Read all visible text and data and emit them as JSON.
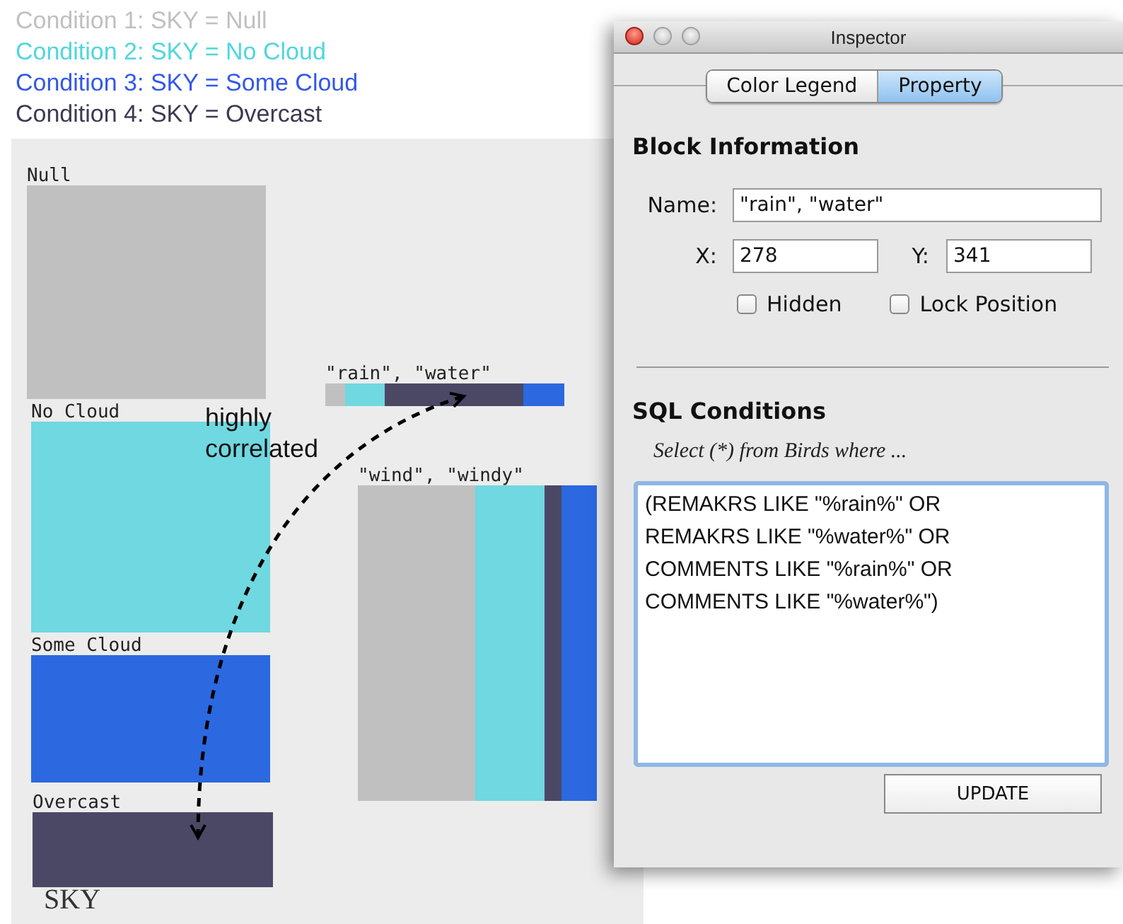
{
  "legend": [
    {
      "text": "Condition 1: SKY = Null",
      "color": "#c0c0c0"
    },
    {
      "text": "Condition 2: SKY = No Cloud",
      "color": "#4fd6de"
    },
    {
      "text": "Condition 3: SKY = Some Cloud",
      "color": "#3358e8"
    },
    {
      "text": "Condition 4: SKY = Overcast",
      "color": "#3c3a52"
    }
  ],
  "canvas": {
    "group_label": "SKY",
    "categories": [
      {
        "label": "Null",
        "color": "#c0c0c0"
      },
      {
        "label": "No Cloud",
        "color": "#70d8e0"
      },
      {
        "label": "Some Cloud",
        "color": "#2c68e0"
      },
      {
        "label": "Overcast",
        "color": "#4b4866"
      }
    ],
    "blocks": [
      {
        "label": "\"rain\", \"water\"",
        "segments": [
          {
            "color": "#c0c0c0"
          },
          {
            "color": "#70d8e0"
          },
          {
            "color": "#4b4866"
          },
          {
            "color": "#2c68e0"
          }
        ]
      },
      {
        "label": "\"wind\", \"windy\"",
        "segments": [
          {
            "color": "#c0c0c0"
          },
          {
            "color": "#70d8e0"
          },
          {
            "color": "#4b4866"
          },
          {
            "color": "#2c68e0"
          }
        ]
      }
    ],
    "annotation": "highly\ncorrelated"
  },
  "inspector": {
    "title": "Inspector",
    "tabs": [
      {
        "label": "Color Legend",
        "selected": false
      },
      {
        "label": "Property",
        "selected": true
      }
    ],
    "block_section": "Block Information",
    "fields": [
      {
        "label": "Name:",
        "value": "\"rain\", \"water\""
      },
      {
        "label": "X:",
        "value": "278"
      },
      {
        "label": "Y:",
        "value": "341"
      }
    ],
    "checkboxes": [
      {
        "label": "Hidden",
        "checked": false
      },
      {
        "label": "Lock Position",
        "checked": false
      }
    ],
    "sql_section": "SQL Conditions",
    "sql_hint": "Select (*) from Birds where ...",
    "sql_text": "(REMAKRS LIKE \"%rain%\" OR\nREMAKRS LIKE \"%water%\" OR\nCOMMENTS LIKE \"%rain%\" OR\nCOMMENTS LIKE \"%water%\")",
    "button": "UPDATE"
  }
}
